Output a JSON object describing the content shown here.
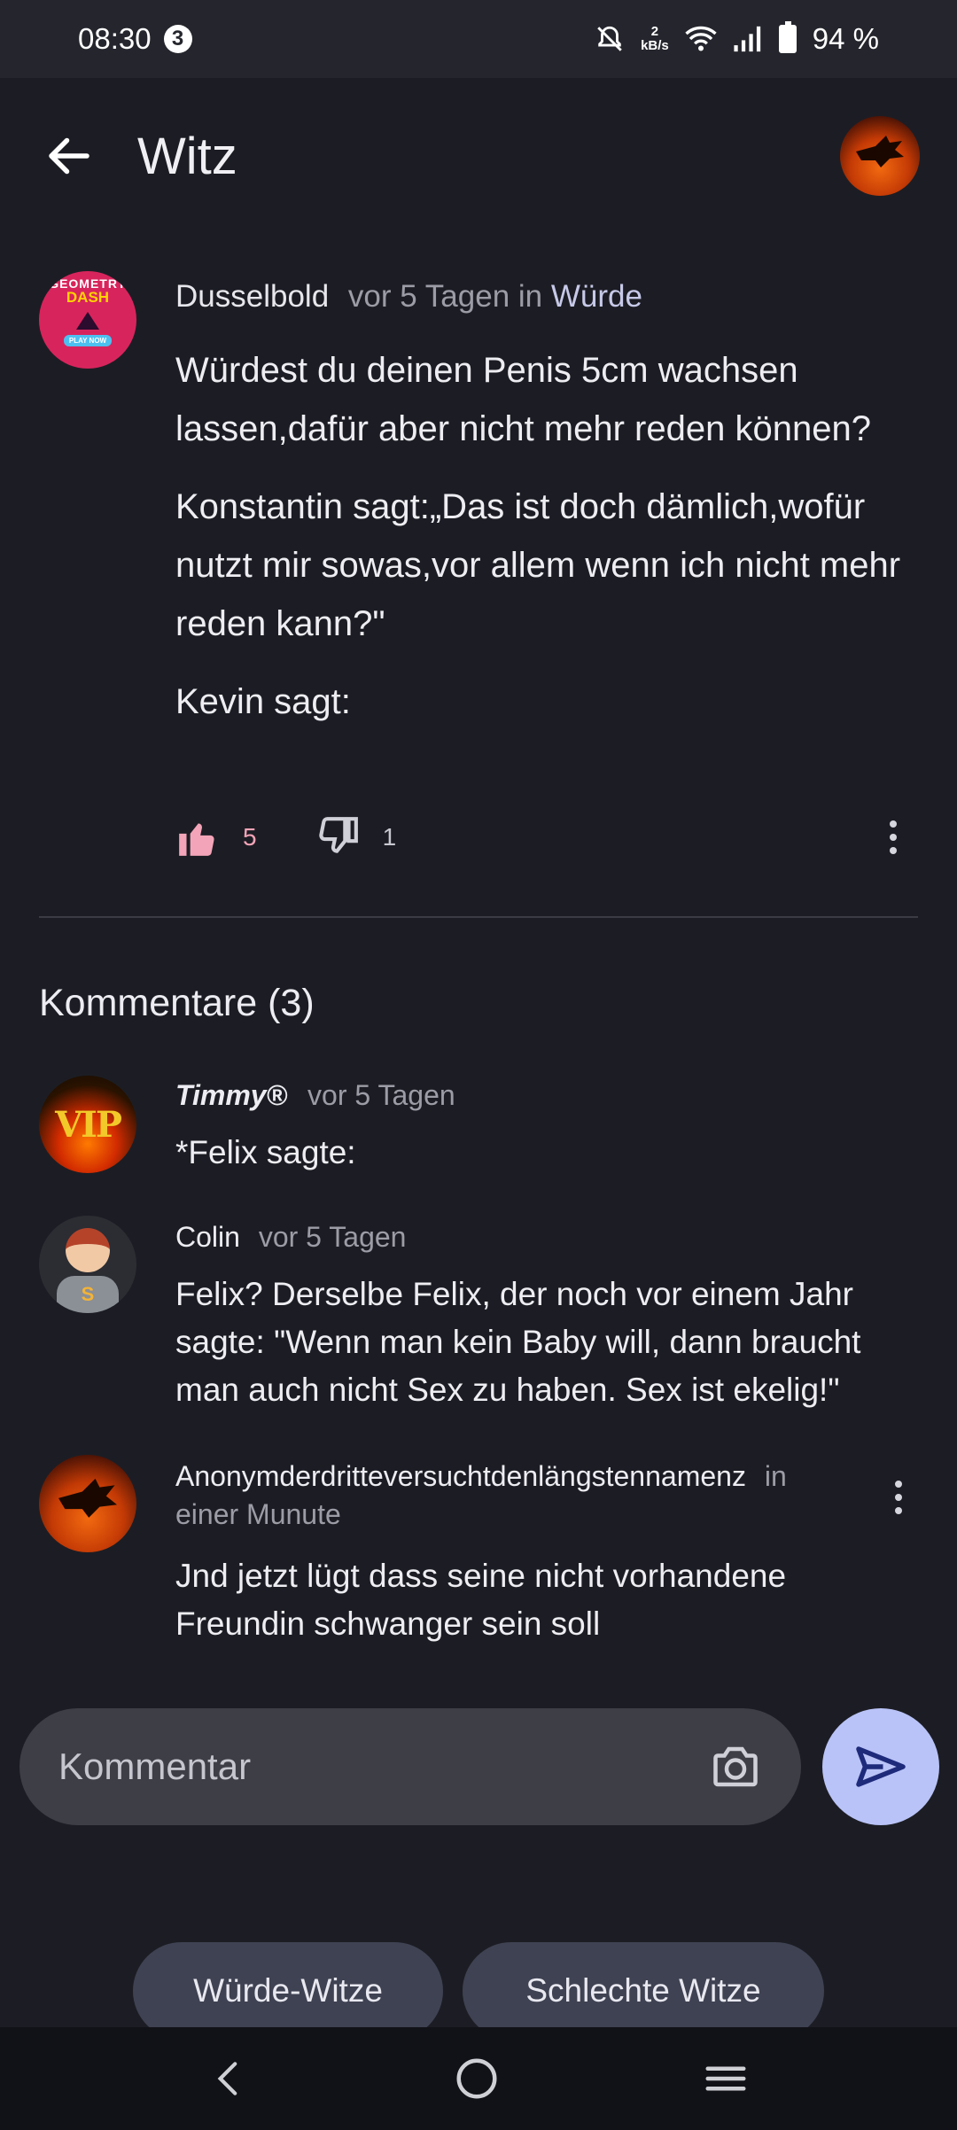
{
  "status_bar": {
    "time": "08:30",
    "notification_count": "3",
    "network_speed_top": "2",
    "network_speed_unit": "kB/s",
    "battery": "94 %"
  },
  "app_bar": {
    "title": "Witz"
  },
  "post": {
    "author": "Dusselbold",
    "time": "vor 5 Tagen",
    "in_label": "in",
    "category": "Würde",
    "paragraphs": [
      "Würdest du deinen Penis 5cm wachsen lassen,dafür aber nicht mehr reden können?",
      "Konstantin sagt:„Das ist doch dämlich,wofür nutzt mir sowas,vor allem wenn ich nicht mehr reden kann?\"",
      "Kevin sagt:"
    ],
    "likes": "5",
    "dislikes": "1",
    "avatar_text_1": "GEOMETRY",
    "avatar_text_2": "DASH",
    "avatar_text_3": "PLAY NOW"
  },
  "comments_section": {
    "title": "Kommentare (3)"
  },
  "comments": [
    {
      "author": "Timmy®",
      "time": "vor 5 Tagen",
      "text": "*Felix sagte:",
      "avatar_text": "VIP"
    },
    {
      "author": "Colin",
      "time": "vor 5 Tagen",
      "text": "Felix? Derselbe Felix, der noch vor einem Jahr sagte: \"Wenn man kein Baby will, dann braucht man auch nicht Sex zu haben. Sex ist ekelig!\"",
      "avatar_text": "S"
    },
    {
      "author": "Anonymderdritteversuchtdenlängstennamenz",
      "time_line1": "in",
      "time_line2": "einer Munute",
      "text": "Jnd jetzt lügt dass seine nicht vorhandene Freundin schwanger sein soll"
    }
  ],
  "comment_input": {
    "placeholder": "Kommentar"
  },
  "chips": [
    "Würde-Witze",
    "Schlechte Witze"
  ],
  "colors": {
    "background": "#1c1d24",
    "accent": "#b9c3f7",
    "like": "#f4a4b8"
  }
}
